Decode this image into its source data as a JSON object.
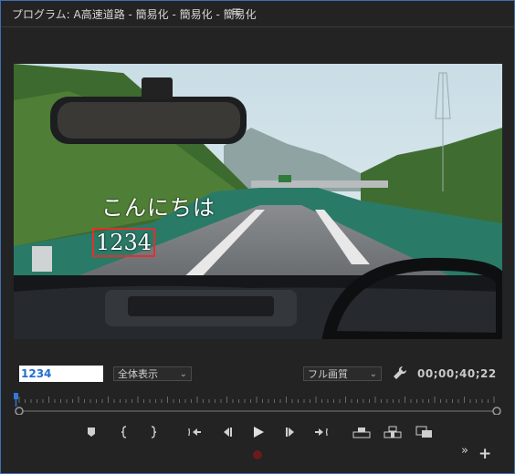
{
  "panel": {
    "title": "プログラム: A高速道路 - 簡易化 - 簡易化 - 簡易化",
    "menu_icon": "hamburger-icon"
  },
  "video": {
    "overlay_text_1": "こんにちは",
    "overlay_text_2": "1234"
  },
  "controls": {
    "timecode_value": "1234",
    "zoom_select": "全体表示",
    "quality_select": "フル画質",
    "settings_icon": "wrench-icon",
    "duration": "00;00;40;22"
  },
  "timeline": {
    "playhead_position": 0,
    "in_point_icon": "circle-marker-icon",
    "out_point_icon": "circle-marker-icon"
  },
  "transport": {
    "buttons": [
      "add-marker-icon",
      "mark-in-icon",
      "mark-out-icon",
      "go-to-in-icon",
      "step-back-icon",
      "play-icon",
      "step-forward-icon",
      "go-to-out-icon",
      "lift-icon",
      "extract-icon",
      "export-frame-icon"
    ],
    "record_icon": "record-icon",
    "more_icon": "double-chevron-icon",
    "add_button_icon": "plus-icon"
  },
  "colors": {
    "panel_bg": "#232323",
    "accent_blue": "#2f7bd6",
    "focus_border": "#3e6fb0",
    "text_box_border": "#e03030"
  }
}
